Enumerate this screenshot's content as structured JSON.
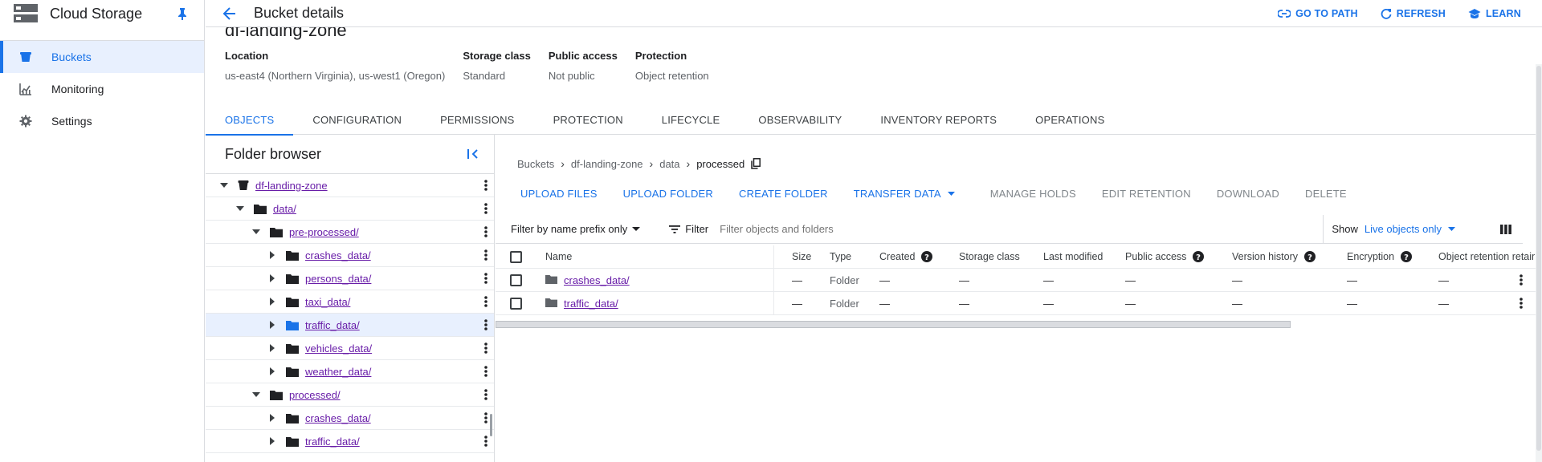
{
  "nav": {
    "product_title": "Cloud Storage",
    "items": [
      {
        "label": "Buckets",
        "icon": "bucket-icon",
        "active": true
      },
      {
        "label": "Monitoring",
        "icon": "chart-icon",
        "active": false
      },
      {
        "label": "Settings",
        "icon": "gear-icon",
        "active": false
      }
    ]
  },
  "header": {
    "title": "Bucket details",
    "actions": [
      {
        "label": "GO TO PATH",
        "icon": "link-icon"
      },
      {
        "label": "REFRESH",
        "icon": "refresh-icon"
      },
      {
        "label": "LEARN",
        "icon": "school-icon"
      }
    ]
  },
  "bucket": {
    "name": "df-landing-zone",
    "info": [
      {
        "key": "Location",
        "value": "us-east4 (Northern Virginia), us-west1 (Oregon)"
      },
      {
        "key": "Storage class",
        "value": "Standard"
      },
      {
        "key": "Public access",
        "value": "Not public"
      },
      {
        "key": "Protection",
        "value": "Object retention"
      }
    ]
  },
  "tabs": [
    "OBJECTS",
    "CONFIGURATION",
    "PERMISSIONS",
    "PROTECTION",
    "LIFECYCLE",
    "OBSERVABILITY",
    "INVENTORY REPORTS",
    "OPERATIONS"
  ],
  "folder_browser": {
    "title": "Folder browser",
    "tree": [
      {
        "name": "df-landing-zone",
        "depth": 0,
        "expanded": true,
        "type": "bucket"
      },
      {
        "name": "data/",
        "depth": 1,
        "expanded": true,
        "type": "folder"
      },
      {
        "name": "pre-processed/",
        "depth": 2,
        "expanded": true,
        "type": "folder"
      },
      {
        "name": "crashes_data/",
        "depth": 3,
        "expanded": false,
        "type": "folder"
      },
      {
        "name": "persons_data/",
        "depth": 3,
        "expanded": false,
        "type": "folder"
      },
      {
        "name": "taxi_data/",
        "depth": 3,
        "expanded": false,
        "type": "folder"
      },
      {
        "name": "traffic_data/",
        "depth": 3,
        "expanded": false,
        "type": "folder",
        "selected": true
      },
      {
        "name": "vehicles_data/",
        "depth": 3,
        "expanded": false,
        "type": "folder"
      },
      {
        "name": "weather_data/",
        "depth": 3,
        "expanded": false,
        "type": "folder"
      },
      {
        "name": "processed/",
        "depth": 2,
        "expanded": true,
        "type": "folder"
      },
      {
        "name": "crashes_data/",
        "depth": 3,
        "expanded": false,
        "type": "folder"
      },
      {
        "name": "traffic_data/",
        "depth": 3,
        "expanded": false,
        "type": "folder"
      }
    ]
  },
  "breadcrumb": {
    "items": [
      "Buckets",
      "df-landing-zone",
      "data"
    ],
    "current": "processed"
  },
  "toolbar": {
    "buttons": [
      {
        "label": "UPLOAD FILES",
        "enabled": true
      },
      {
        "label": "UPLOAD FOLDER",
        "enabled": true
      },
      {
        "label": "CREATE FOLDER",
        "enabled": true
      },
      {
        "label": "TRANSFER DATA",
        "enabled": true,
        "dropdown": true
      },
      {
        "label": "MANAGE HOLDS",
        "enabled": false
      },
      {
        "label": "EDIT RETENTION",
        "enabled": false
      },
      {
        "label": "DOWNLOAD",
        "enabled": false
      },
      {
        "label": "DELETE",
        "enabled": false
      }
    ]
  },
  "filter": {
    "prefix_label": "Filter by name prefix only",
    "filter_label": "Filter",
    "placeholder": "Filter objects and folders",
    "show_label": "Show",
    "show_value": "Live objects only"
  },
  "table": {
    "headers": {
      "name": "Name",
      "size": "Size",
      "type": "Type",
      "created": "Created",
      "storage_class": "Storage class",
      "last_modified": "Last modified",
      "public_access": "Public access",
      "version_history": "Version history",
      "encryption": "Encryption",
      "retention": "Object retention retain"
    },
    "rows": [
      {
        "name": "crashes_data/",
        "size": "—",
        "type": "Folder",
        "created": "—",
        "storage_class": "—",
        "last_modified": "—",
        "public_access": "—",
        "version_history": "—",
        "encryption": "—",
        "retention": "—"
      },
      {
        "name": "traffic_data/",
        "size": "—",
        "type": "Folder",
        "created": "—",
        "storage_class": "—",
        "last_modified": "—",
        "public_access": "—",
        "version_history": "—",
        "encryption": "—",
        "retention": "—"
      }
    ]
  },
  "colors": {
    "accent": "#1a73e8",
    "visited_link": "#681da8",
    "selected_row": "#e8f0fe"
  }
}
